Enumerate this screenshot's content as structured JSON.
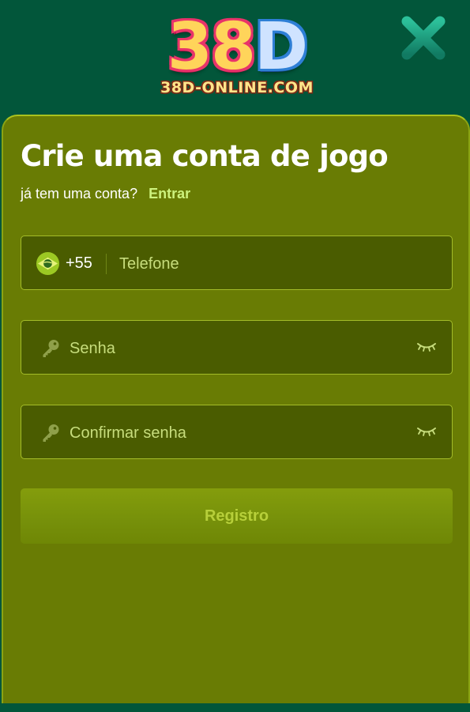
{
  "header": {
    "logo_main_prefix": "38",
    "logo_main_suffix": "D",
    "logo_subtitle": "38D-ONLINE.COM",
    "close_icon": "close-x-icon"
  },
  "form": {
    "title": "Crie uma conta de jogo",
    "have_account_text": "já tem uma conta?",
    "login_link": "Entrar",
    "phone": {
      "country_icon": "brazil-flag-icon",
      "dial_code": "+55",
      "placeholder": "Telefone",
      "value": ""
    },
    "password": {
      "icon": "key-icon",
      "placeholder": "Senha",
      "value": "",
      "toggle_icon": "eye-closed-icon"
    },
    "confirm_password": {
      "icon": "key-icon",
      "placeholder": "Confirmar senha",
      "value": "",
      "toggle_icon": "eye-closed-icon"
    },
    "submit_label": "Registro"
  },
  "colors": {
    "background": "#02563a",
    "panel": "#697c04",
    "field_bg": "#4a5c00",
    "field_border": "#a3bc28",
    "accent_link": "#cdf27d",
    "close_icon": "#1ea384"
  }
}
